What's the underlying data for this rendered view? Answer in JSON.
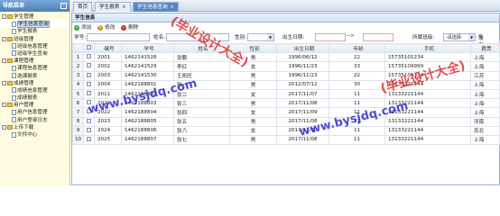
{
  "sidebar": {
    "title": "导航菜单",
    "collapse": "-",
    "tree": [
      {
        "level": 0,
        "label": "学生管理",
        "toggle": "-",
        "type": "folder"
      },
      {
        "level": 1,
        "label": "学生信息查询",
        "type": "leaf",
        "selected": true
      },
      {
        "level": 1,
        "label": "学生报表",
        "type": "leaf"
      },
      {
        "level": 0,
        "label": "班级管理",
        "toggle": "-",
        "type": "folder"
      },
      {
        "level": 1,
        "label": "班级信息管理",
        "type": "leaf"
      },
      {
        "level": 1,
        "label": "班级学生查询",
        "type": "leaf"
      },
      {
        "level": 0,
        "label": "课程管理",
        "toggle": "-",
        "type": "folder"
      },
      {
        "level": 1,
        "label": "课程信息管理",
        "type": "leaf"
      },
      {
        "level": 1,
        "label": "选课报表",
        "type": "leaf"
      },
      {
        "level": 0,
        "label": "成绩管理",
        "toggle": "-",
        "type": "folder"
      },
      {
        "level": 1,
        "label": "成绩信息管理",
        "type": "leaf"
      },
      {
        "level": 1,
        "label": "成绩报表",
        "type": "leaf"
      },
      {
        "level": 0,
        "label": "用户管理",
        "toggle": "-",
        "type": "folder"
      },
      {
        "level": 1,
        "label": "用户信息管理",
        "type": "leaf"
      },
      {
        "level": 1,
        "label": "用户登录日志",
        "type": "leaf"
      },
      {
        "level": 0,
        "label": "上传下载",
        "toggle": "-",
        "type": "folder"
      },
      {
        "level": 1,
        "label": "文件中心",
        "type": "leaf"
      }
    ]
  },
  "tabs": [
    {
      "label": "首页"
    },
    {
      "label": "学生报表",
      "close": "×"
    },
    {
      "label": "学生信息查询",
      "close": "×",
      "active": true
    }
  ],
  "panel": {
    "title": "学生信息"
  },
  "toolbar": {
    "add": "添加",
    "edit": "修改",
    "delete": "删除"
  },
  "search": {
    "student_no_label": "学号:",
    "name_label": "姓名:",
    "gender_label": "性别:",
    "birth_label": "出生日期:",
    "range_sep": "-->",
    "class_label": "所属班级:",
    "class_select": "-请选择-",
    "search_btn": "搜索"
  },
  "table": {
    "headers": [
      "",
      "编号",
      "学号",
      "姓名",
      "性别",
      "出生日期",
      "年龄",
      "手机",
      "籍贯"
    ],
    "rows": [
      [
        "1",
        "2001",
        "1462141528",
        "张鹏",
        "男",
        "1996/06/12",
        "22",
        "15735101234",
        "上海"
      ],
      [
        "2",
        "2002",
        "1462141529",
        "李红",
        "女",
        "1996/11/23",
        "33",
        "15735109999",
        "上海"
      ],
      [
        "3",
        "2003",
        "1462141530",
        "王凯旺",
        "男",
        "1996/11/23",
        "22",
        "15735102134",
        "江苏"
      ],
      [
        "4",
        "2004",
        "1462188801",
        "张一",
        "男",
        "2012/07/12",
        "30",
        "13133221144",
        "上海"
      ],
      [
        "5",
        "2011",
        "1462188802",
        "张二",
        "女",
        "2017/11/07",
        "11",
        "13133221144",
        "上海"
      ],
      [
        "6",
        "2021",
        "1462188803",
        "张三",
        "男",
        "2017/11/08",
        "11",
        "13133221144",
        "上海"
      ],
      [
        "7",
        "2022",
        "1462188804",
        "张四",
        "女",
        "2017/11/09",
        "11",
        "13133221144",
        "上海"
      ],
      [
        "8",
        "2023",
        "1462188805",
        "张五",
        "男",
        "2017/11/08",
        "11",
        "13133221144",
        "河南"
      ],
      [
        "9",
        "2024",
        "1462188806",
        "张六",
        "女",
        "2017/11/07",
        "11",
        "13133221144",
        "苏北"
      ],
      [
        "10",
        "2025",
        "1462188807",
        "张七",
        "男",
        "2017/11/08",
        "11",
        "13133221144",
        "上海"
      ]
    ]
  },
  "watermarks": {
    "a": "www.bysjdq.com",
    "b": "(毕业设计大全)"
  },
  "colors": {
    "accent": "#5b86c5",
    "sidebar_bg": "#fffbe0",
    "watermark_blue": "#2f2fd0",
    "watermark_red": "#e03030"
  }
}
